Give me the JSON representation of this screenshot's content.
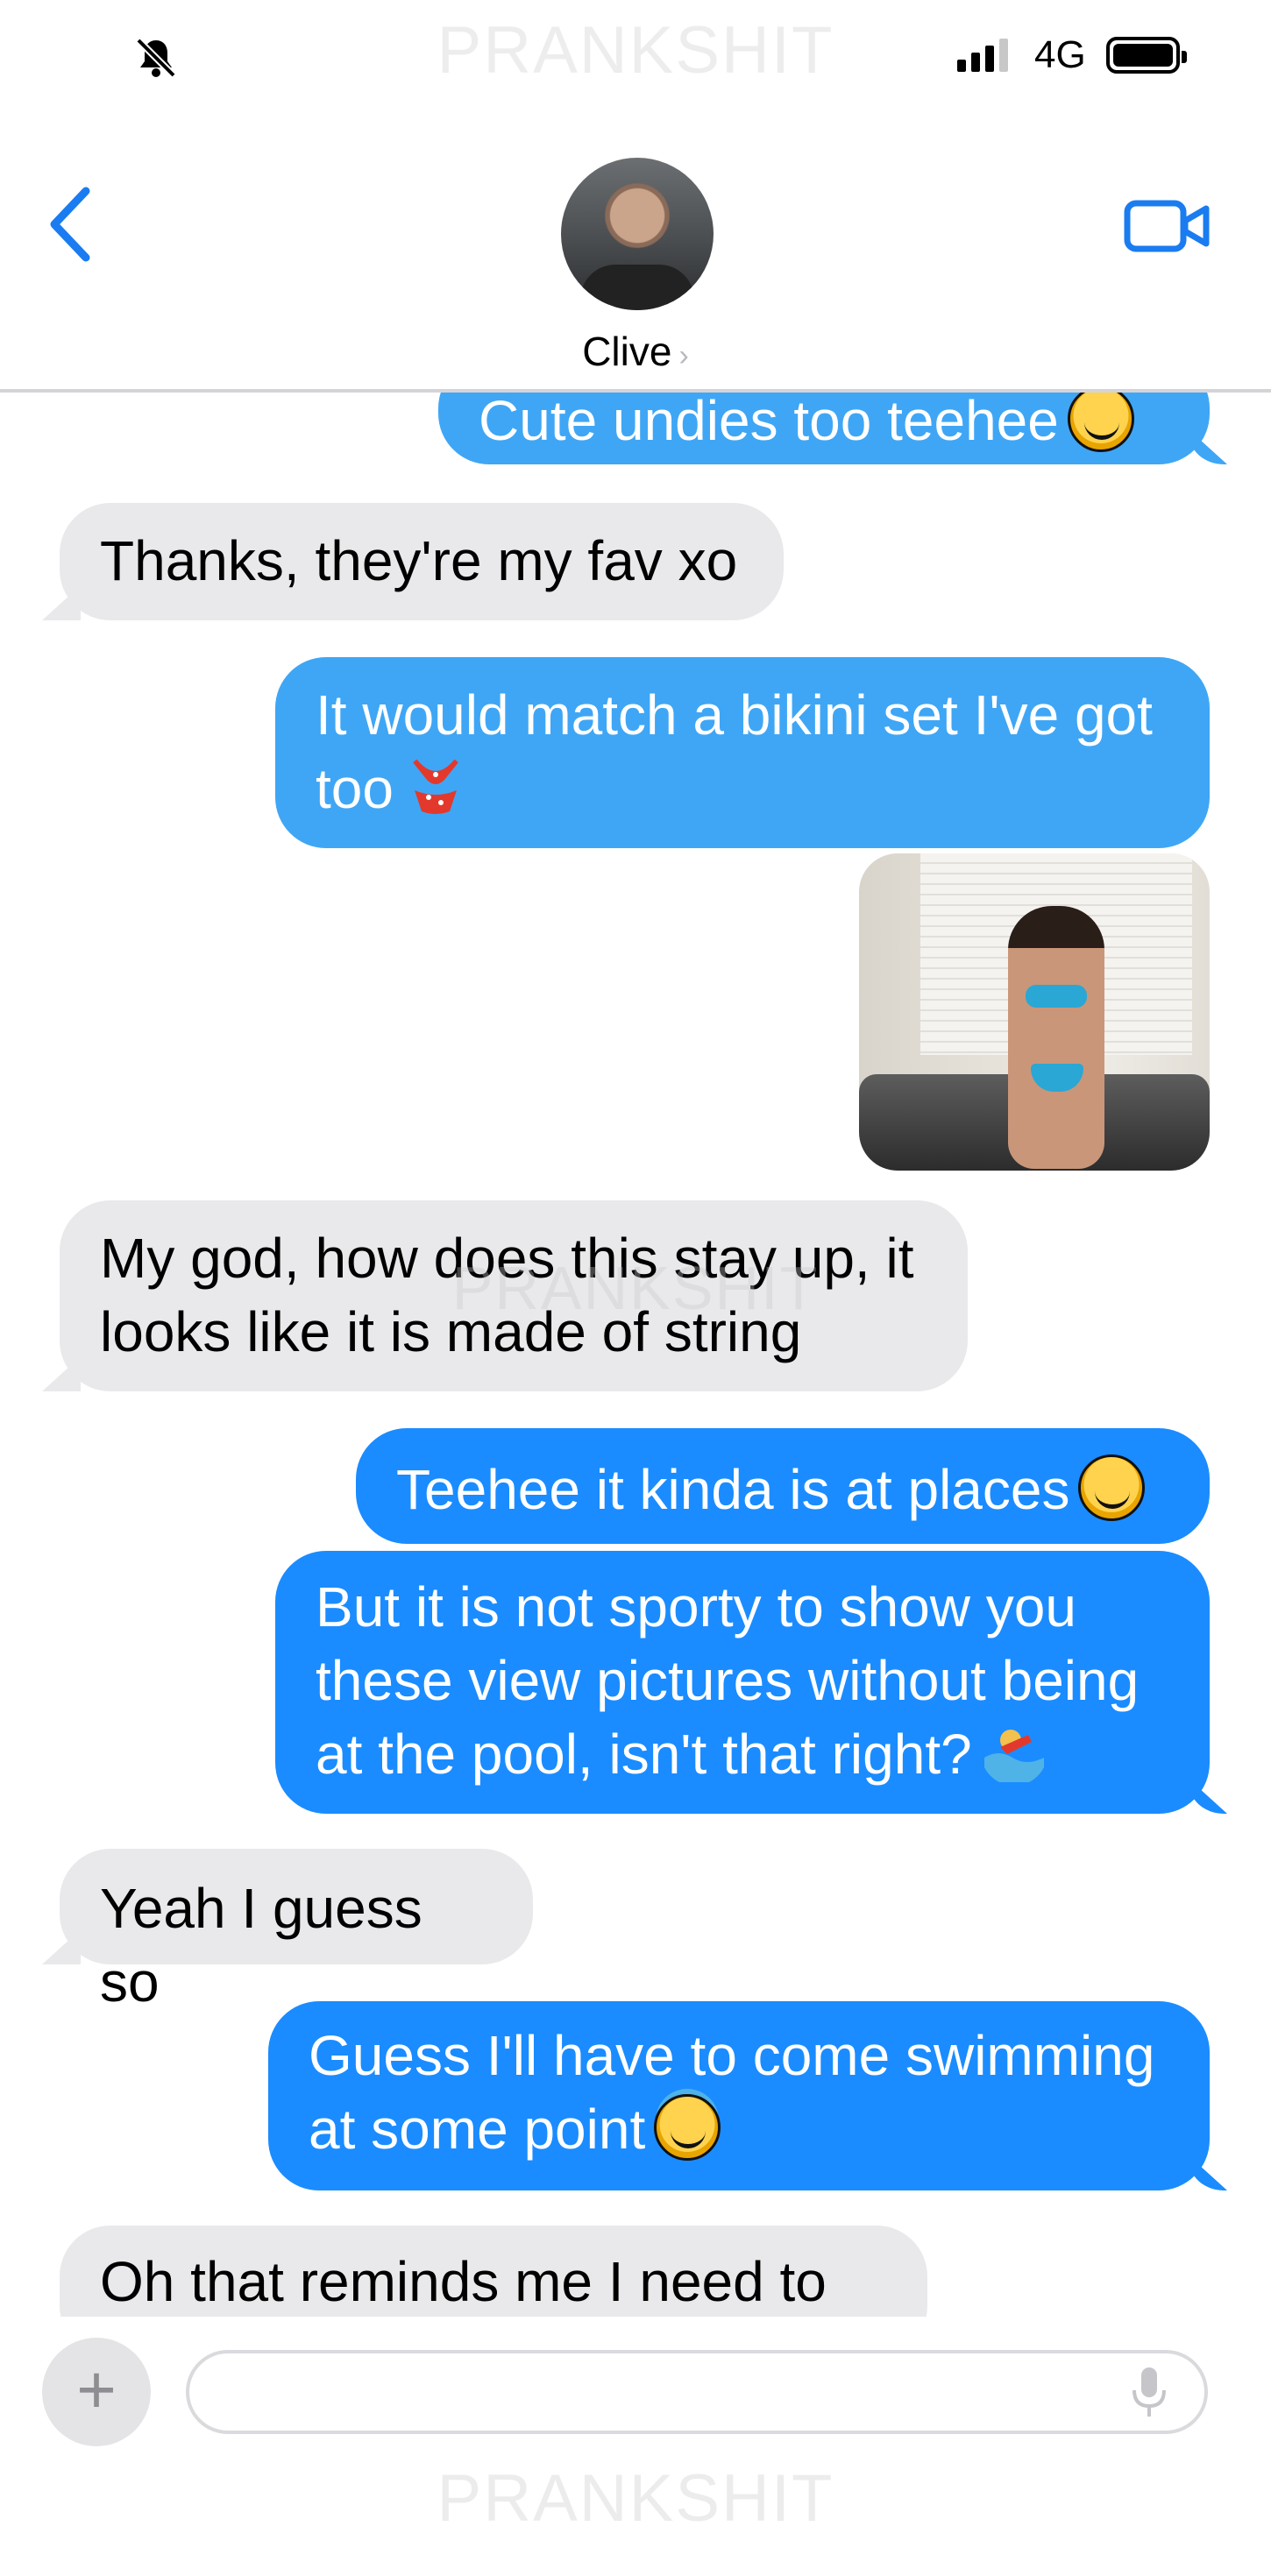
{
  "status_bar": {
    "watermark": "PRANKSHIT",
    "carrier": "4G",
    "icons": [
      "bell-slash-icon",
      "signal-icon",
      "battery-icon"
    ]
  },
  "header": {
    "contact_name": "Clive",
    "chevron": "›",
    "icons": [
      "back-chevron-icon",
      "video-call-icon"
    ]
  },
  "messages": [
    {
      "from": "me",
      "text": "Cute undies too teehee",
      "emoji": "yum-face"
    },
    {
      "from": "them",
      "text": "Thanks, they're my fav xo"
    },
    {
      "from": "me",
      "text": "It would match a bikini set I've got too",
      "emoji": "bikini"
    },
    {
      "from": "me",
      "type": "image",
      "description_icon": "photo-attachment"
    },
    {
      "from": "them",
      "text": "My god, how does this stay up, it looks like it is made of string"
    },
    {
      "from": "me",
      "text": "Teehee it kinda is at places",
      "emoji": "smirk"
    },
    {
      "from": "me",
      "text": "But it is not sporty to show you these view pictures without being at the pool, isn't that right?",
      "emoji": "swimmer"
    },
    {
      "from": "them",
      "text": "Yeah I guess so"
    },
    {
      "from": "me",
      "text": "Guess I'll have to come swimming at some point",
      "emoji": "halo-face"
    },
    {
      "from": "them",
      "text": "Oh that reminds me I need to get"
    }
  ],
  "mid_watermark": "PRANKSHIT",
  "input_bar": {
    "plus": "+",
    "placeholder": "",
    "icons": [
      "plus-icon",
      "microphone-icon"
    ]
  },
  "bottom_watermark": "PRANKSHIT",
  "colors": {
    "sent_bubble": "#1a8cff",
    "sent_bubble_light": "#3fa6f5",
    "received_bubble": "#e9e9eb",
    "accent": "#1a7cf0"
  }
}
